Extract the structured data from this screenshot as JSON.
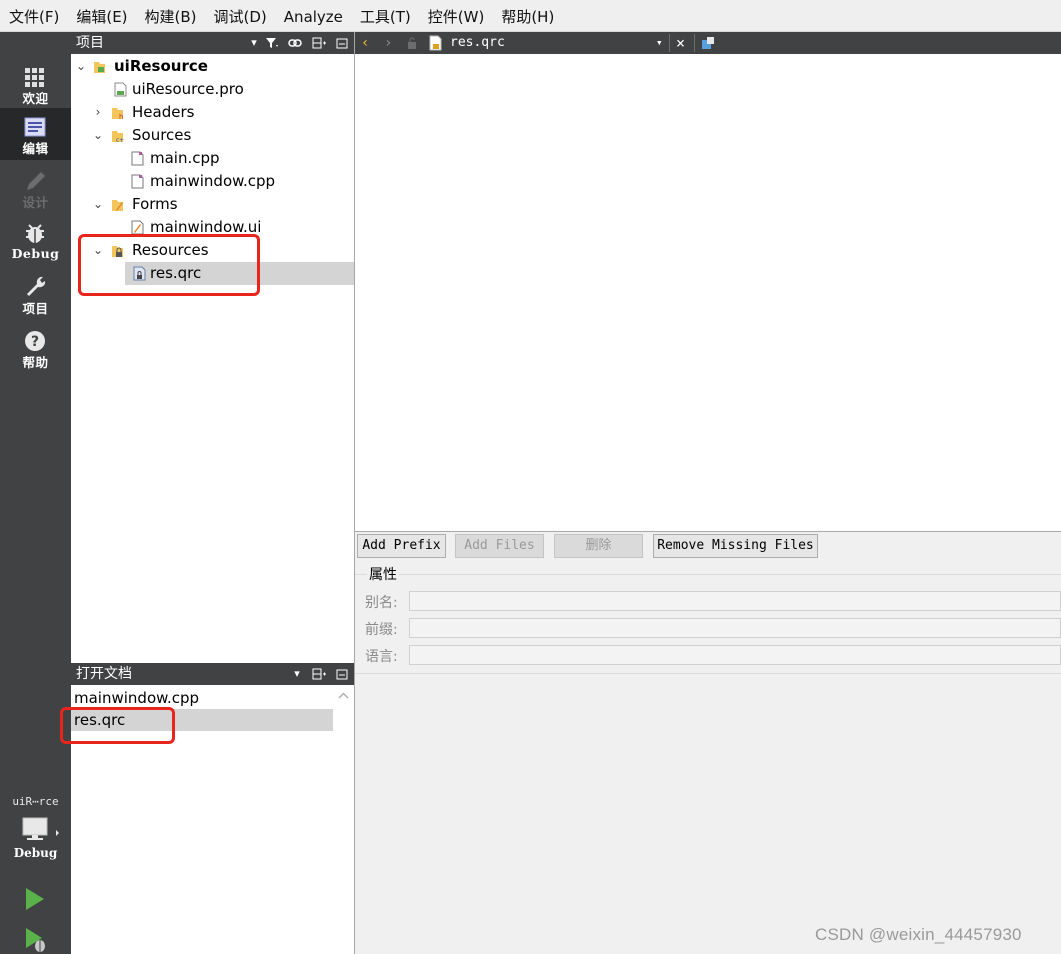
{
  "menubar": {
    "items": [
      "文件(F)",
      "编辑(E)",
      "构建(B)",
      "调试(D)",
      "Analyze",
      "工具(T)",
      "控件(W)",
      "帮助(H)"
    ]
  },
  "modebar": {
    "modes": [
      {
        "label": "欢迎",
        "icon": "grid-icon"
      },
      {
        "label": "编辑",
        "icon": "edit-document-icon",
        "active": true
      },
      {
        "label": "设计",
        "icon": "pencil-icon",
        "disabled": true
      },
      {
        "label": "Debug",
        "icon": "bug-icon"
      },
      {
        "label": "项目",
        "icon": "wrench-icon"
      },
      {
        "label": "帮助",
        "icon": "help-icon"
      }
    ],
    "kit_label": "uiR⋯rce",
    "kit_mode_label": "Debug"
  },
  "project_pane": {
    "title": "项目",
    "tree": [
      {
        "label": "uiResource",
        "level": 0,
        "expanded": true,
        "icon": "project-folder-icon"
      },
      {
        "label": "uiResource.pro",
        "level": 1,
        "icon": "pro-file-icon"
      },
      {
        "label": "Headers",
        "level": 1,
        "expanded": false,
        "icon": "headers-folder-icon"
      },
      {
        "label": "Sources",
        "level": 1,
        "expanded": true,
        "icon": "sources-folder-icon"
      },
      {
        "label": "main.cpp",
        "level": 2,
        "icon": "cpp-file-icon"
      },
      {
        "label": "mainwindow.cpp",
        "level": 2,
        "icon": "cpp-file-icon"
      },
      {
        "label": "Forms",
        "level": 1,
        "expanded": true,
        "icon": "forms-folder-icon"
      },
      {
        "label": "mainwindow.ui",
        "level": 2,
        "icon": "ui-file-icon"
      },
      {
        "label": "Resources",
        "level": 1,
        "expanded": true,
        "icon": "resources-folder-icon"
      },
      {
        "label": "res.qrc",
        "level": 2,
        "icon": "qrc-file-icon",
        "selected": true
      }
    ]
  },
  "open_documents": {
    "title": "打开文档",
    "items": [
      {
        "label": "mainwindow.cpp"
      },
      {
        "label": "res.qrc",
        "selected": true
      }
    ]
  },
  "editor": {
    "current_file": "res.qrc"
  },
  "resource_editor": {
    "buttons": {
      "add_prefix": "Add Prefix",
      "add_files": "Add Files",
      "delete": "删除",
      "remove_missing": "Remove Missing Files"
    },
    "properties_title": "属性",
    "fields": {
      "alias_label": "别名:",
      "prefix_label": "前缀:",
      "language_label": "语言:"
    }
  },
  "watermark": "CSDN @weixin_44457930",
  "colors": {
    "sidebar_bg": "#404244",
    "highlight_red": "#e8241c",
    "selection": "#d4d4d4"
  }
}
